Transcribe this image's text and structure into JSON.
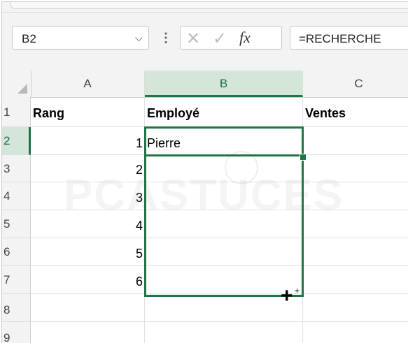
{
  "namebox": {
    "ref": "B2",
    "chevron": "⌵"
  },
  "formula_bar": {
    "separator": "⋮",
    "cancel": "✕",
    "enter": "✓",
    "fx": "fx",
    "content": "=RECHERCHE"
  },
  "columns": [
    "A",
    "B",
    "C"
  ],
  "rows": [
    "1",
    "2",
    "3",
    "4",
    "5",
    "6",
    "7",
    "8",
    "9"
  ],
  "cells": {
    "header": {
      "a": "Rang",
      "b": "Employé",
      "c": "Ventes"
    },
    "ranks": [
      "1",
      "2",
      "3",
      "4",
      "5",
      "6"
    ],
    "b2": "Pierre"
  },
  "watermark": "PCASTUCES",
  "cursor": {
    "main": "+",
    "small": "+"
  },
  "colors": {
    "accent": "#217346",
    "selected_header_bg": "#d4e6da"
  }
}
